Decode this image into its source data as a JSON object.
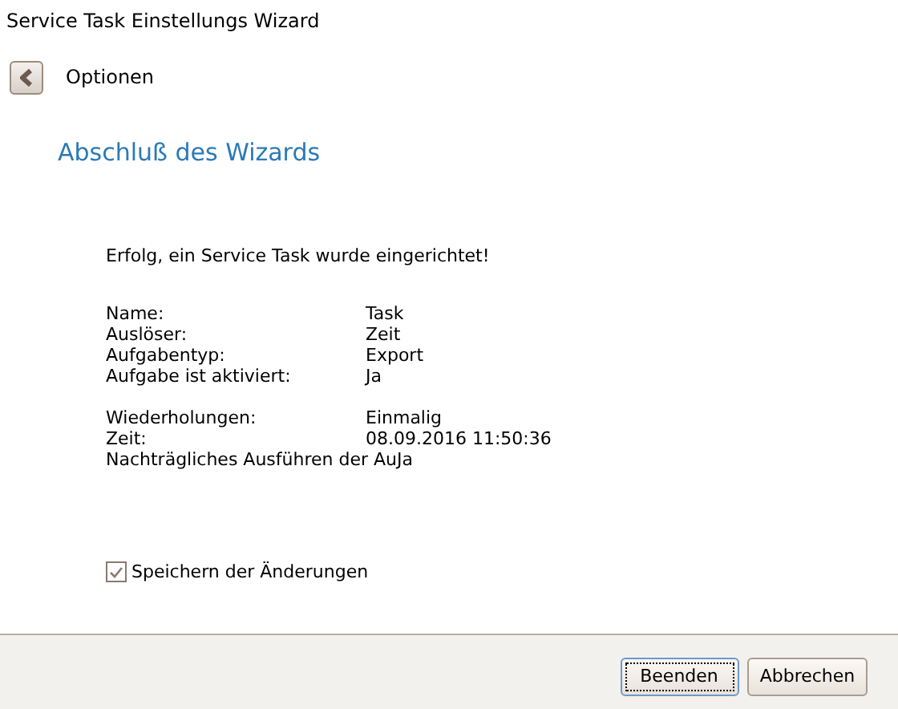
{
  "window": {
    "title": "Service Task Einstellungs Wizard"
  },
  "header": {
    "title": "Optionen"
  },
  "heading": "Abschluß des Wizards",
  "message": "Erfolg, ein Service Task wurde eingerichtet!",
  "groups": [
    [
      {
        "label": "Name:",
        "value": "Task"
      },
      {
        "label": "Auslöser:",
        "value": "Zeit"
      },
      {
        "label": "Aufgabentyp:",
        "value": "Export"
      },
      {
        "label": "Aufgabe ist aktiviert:",
        "value": "Ja"
      }
    ],
    [
      {
        "label": "Wiederholungen:",
        "value": "Einmalig"
      },
      {
        "label": "Zeit:",
        "value": "08.09.2016 11:50:36"
      },
      {
        "label": "Nachträgliches Ausführen der Au",
        "value": "Ja"
      }
    ]
  ],
  "save_checkbox": {
    "label": "Speichern der Änderungen",
    "checked": true
  },
  "buttons": [
    {
      "label": "Beenden",
      "selected": true
    },
    {
      "label": "Abbrechen",
      "selected": false
    }
  ]
}
